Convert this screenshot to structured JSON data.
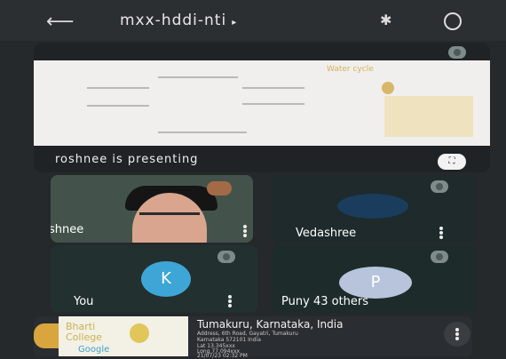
{
  "topbar": {
    "back_icon": "back-arrow-icon",
    "meeting_code": "mxx-hddi-nti",
    "caret": "▸",
    "bluetooth_icon": "bluetooth-icon",
    "switch_camera_icon": "switch-camera-icon"
  },
  "presentation": {
    "label": "roshnee is presenting",
    "slide_heading": "Water cycle"
  },
  "participants": [
    {
      "name": "Roshnee",
      "visible_label": "shnee"
    },
    {
      "name": "Vedashree"
    },
    {
      "name": "You",
      "initial": "K"
    },
    {
      "name": "Puny",
      "initial": "P",
      "others": "43 others"
    }
  ],
  "location_card": {
    "title": "Tumakuru, Karnataka, India",
    "lines": [
      "Address, 6th Road, Gayatri, Tumakuru",
      "Karnataka 572101 India",
      "Lat 13.345xxx",
      "Long 77.094xxx",
      "21/07/23 02:32 PM"
    ],
    "thumb_title_line1": "Bharti",
    "thumb_title_line2": "College",
    "thumb_brand": "Google"
  },
  "colors": {
    "background": "#25292c",
    "accent_you": "#3ea6d6",
    "accent_p": "#b7c4dc"
  }
}
